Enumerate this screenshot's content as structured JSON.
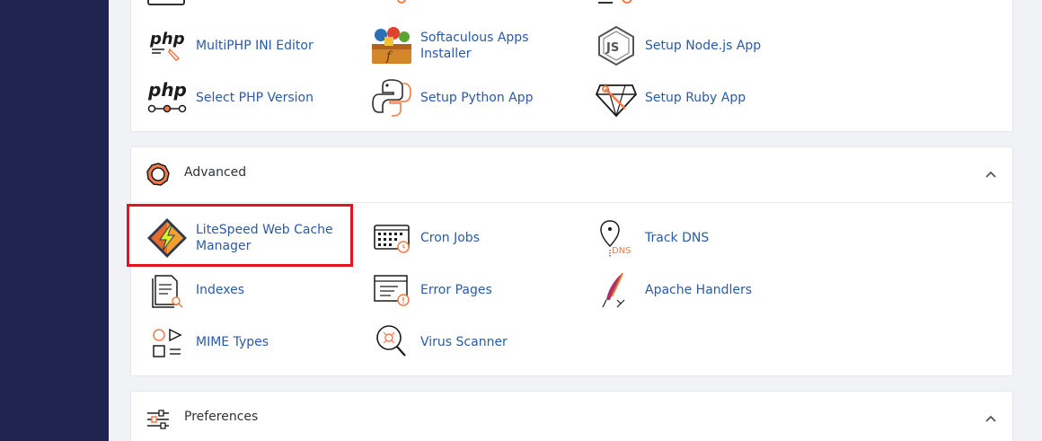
{
  "top_section": {
    "items": [
      {
        "label": "MultiPHP INI Editor",
        "icon": "php-ini-icon"
      },
      {
        "label": "Softaculous Apps Installer",
        "icon": "softaculous-icon"
      },
      {
        "label": "Setup Node.js App",
        "icon": "nodejs-icon"
      },
      {
        "label": "Select PHP Version",
        "icon": "php-version-icon"
      },
      {
        "label": "Setup Python App",
        "icon": "python-icon"
      },
      {
        "label": "Setup Ruby App",
        "icon": "ruby-icon"
      }
    ]
  },
  "advanced": {
    "title": "Advanced",
    "items": [
      {
        "label": "LiteSpeed Web Cache Manager",
        "icon": "litespeed-icon"
      },
      {
        "label": "Cron Jobs",
        "icon": "cron-jobs-icon"
      },
      {
        "label": "Track DNS",
        "icon": "track-dns-icon"
      },
      {
        "label": "Indexes",
        "icon": "indexes-icon"
      },
      {
        "label": "Error Pages",
        "icon": "error-pages-icon"
      },
      {
        "label": "Apache Handlers",
        "icon": "apache-feather-icon"
      },
      {
        "label": "MIME Types",
        "icon": "mime-types-icon"
      },
      {
        "label": "Virus Scanner",
        "icon": "virus-scanner-icon"
      }
    ]
  },
  "preferences": {
    "title": "Preferences"
  },
  "icon_text": {
    "php": "php",
    "dns": "DNS",
    "js": "JS"
  },
  "colors": {
    "sidebar": "#20244f",
    "link": "#2a5aa8",
    "accent_orange": "#f07c4b",
    "highlight_red": "#e1141f"
  }
}
